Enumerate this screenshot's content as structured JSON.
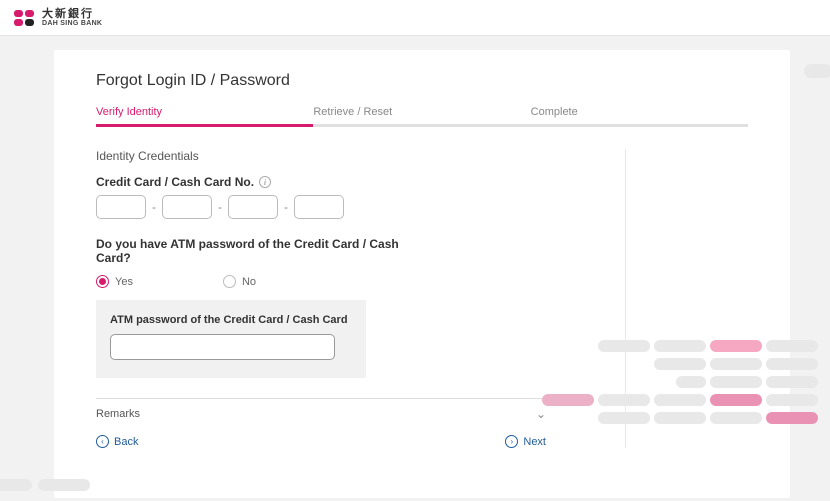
{
  "brand": {
    "name_cn": "大新銀行",
    "name_en": "DAH SING BANK"
  },
  "page": {
    "title": "Forgot Login ID / Password"
  },
  "tabs": [
    {
      "label": "Verify Identity",
      "active": true
    },
    {
      "label": "Retrieve / Reset",
      "active": false
    },
    {
      "label": "Complete",
      "active": false
    }
  ],
  "section": {
    "heading": "Identity Credentials",
    "card_label": "Credit Card / Cash Card No.",
    "dash": "-",
    "question": "Do you have ATM password of the Credit Card / Cash Card?",
    "yes": "Yes",
    "no": "No",
    "pw_label": "ATM password of the Credit Card / Cash Card"
  },
  "remarks": {
    "label": "Remarks"
  },
  "nav": {
    "back": "Back",
    "next": "Next"
  }
}
